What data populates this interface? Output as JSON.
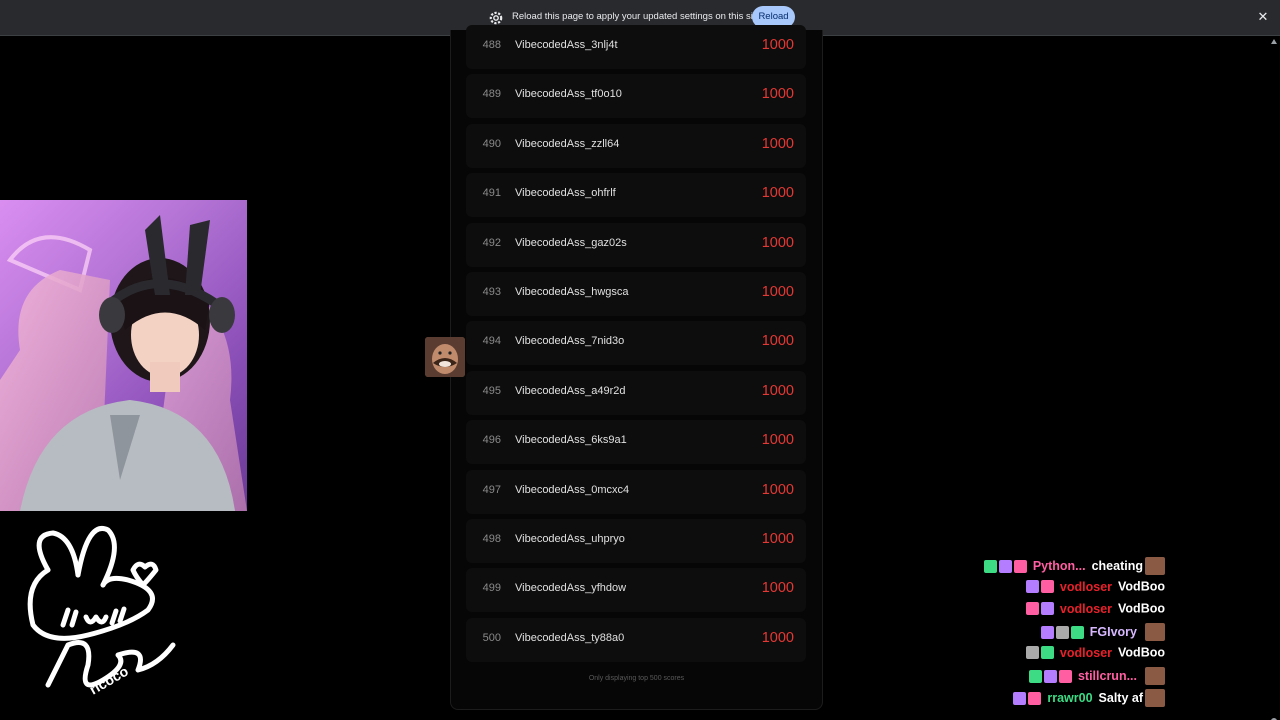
{
  "infobar": {
    "message": "Reload this page to apply your updated settings on this site",
    "reload_label": "Reload",
    "close_glyph": "✕",
    "settings_icon": "gear-icon"
  },
  "leaderboard": {
    "rows": [
      {
        "rank": "488",
        "name": "VibecodedAss_3nlj4t",
        "score": "1000"
      },
      {
        "rank": "489",
        "name": "VibecodedAss_tf0o10",
        "score": "1000"
      },
      {
        "rank": "490",
        "name": "VibecodedAss_zzll64",
        "score": "1000"
      },
      {
        "rank": "491",
        "name": "VibecodedAss_ohfrlf",
        "score": "1000"
      },
      {
        "rank": "492",
        "name": "VibecodedAss_gaz02s",
        "score": "1000"
      },
      {
        "rank": "493",
        "name": "VibecodedAss_hwgsca",
        "score": "1000"
      },
      {
        "rank": "494",
        "name": "VibecodedAss_7nid3o",
        "score": "1000"
      },
      {
        "rank": "495",
        "name": "VibecodedAss_a49r2d",
        "score": "1000"
      },
      {
        "rank": "496",
        "name": "VibecodedAss_6ks9a1",
        "score": "1000"
      },
      {
        "rank": "497",
        "name": "VibecodedAss_0mcxc4",
        "score": "1000"
      },
      {
        "rank": "498",
        "name": "VibecodedAss_uhpryo",
        "score": "1000"
      },
      {
        "rank": "499",
        "name": "VibecodedAss_yfhdow",
        "score": "1000"
      },
      {
        "rank": "500",
        "name": "VibecodedAss_ty88a0",
        "score": "1000"
      }
    ],
    "footnote": "Only displaying top 500 scores",
    "score_color": "#e53935"
  },
  "logo": {
    "text": "ricoco"
  },
  "chat": {
    "messages": [
      {
        "user": "Python...",
        "text": "cheating",
        "user_color": "#ff5fa2",
        "emote_after": true
      },
      {
        "user": "vodloser",
        "text": "VodBoo",
        "user_color": "#e8202a",
        "emote_after": false
      },
      {
        "user": "vodloser",
        "text": "VodBoo",
        "user_color": "#e8202a",
        "emote_after": false
      },
      {
        "user": "FGIvory",
        "text": "",
        "user_color": "#d7b8ff",
        "emote_after": true
      },
      {
        "user": "vodloser",
        "text": "VodBoo",
        "user_color": "#e8202a",
        "emote_after": false
      },
      {
        "user": "stillcrun...",
        "text": "",
        "user_color": "#ff5fa2",
        "emote_after": true
      },
      {
        "user": "rrawr00",
        "text": "Salty af",
        "user_color": "#3ddc84",
        "emote_after": true
      }
    ]
  }
}
